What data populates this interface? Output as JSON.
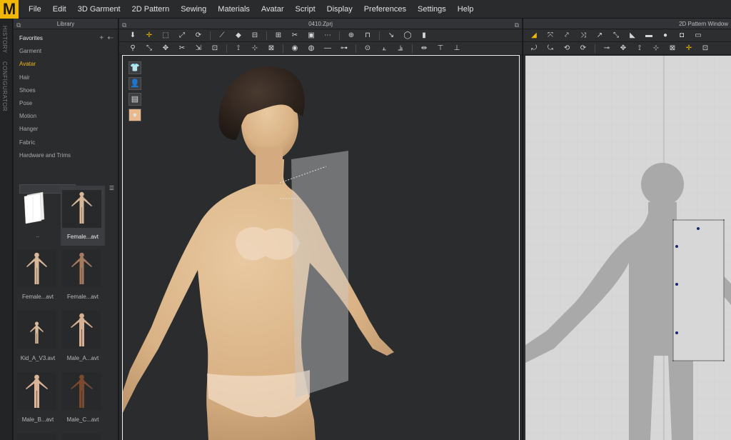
{
  "app": {
    "logo_letter": "M",
    "accent_color": "#f2b705"
  },
  "menu": [
    "File",
    "Edit",
    "3D Garment",
    "2D Pattern",
    "Sewing",
    "Materials",
    "Avatar",
    "Script",
    "Display",
    "Preferences",
    "Settings",
    "Help"
  ],
  "side_tabs": {
    "history": "HISTORY",
    "configurator": "CONFIGURATOR"
  },
  "library": {
    "title": "Library",
    "tree": [
      "Favorites",
      "Garment",
      "Avatar",
      "Hair",
      "Shoes",
      "Pose",
      "Motion",
      "Hanger",
      "Fabric",
      "Hardware and Trims"
    ],
    "active_item": "Avatar",
    "search_placeholder": "",
    "items": [
      {
        "caption": "..",
        "kind": "folder"
      },
      {
        "caption": "Female...avt",
        "kind": "avatar",
        "selected": true
      },
      {
        "caption": "Female...avt",
        "kind": "avatar"
      },
      {
        "caption": "Female...avt",
        "kind": "avatar"
      },
      {
        "caption": "Kid_A_V3.avt",
        "kind": "avatar"
      },
      {
        "caption": "Male_A...avt",
        "kind": "avatar"
      },
      {
        "caption": "Male_B...avt",
        "kind": "avatar"
      },
      {
        "caption": "Male_C...avt",
        "kind": "avatar"
      }
    ]
  },
  "viewport": {
    "title": "0410.Zprj"
  },
  "pattern_window": {
    "title": "2D Pattern Window"
  }
}
